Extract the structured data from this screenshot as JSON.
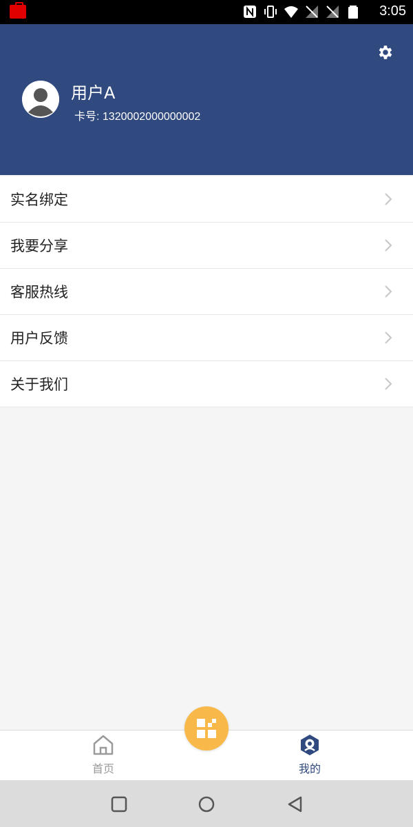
{
  "status_bar": {
    "time": "3:05",
    "icons": [
      "notification-app-icon",
      "nfc-icon",
      "vibrate-icon",
      "wifi-icon",
      "signal-off-icon",
      "signal-off-icon",
      "battery-icon"
    ]
  },
  "header": {
    "background": "#30497f",
    "user_name": "用户A",
    "card_number": "卡号: 1320002000000002",
    "settings_icon": "gear-icon",
    "avatar_icon": "user-avatar-icon"
  },
  "menu": {
    "items": [
      {
        "label": "实名绑定"
      },
      {
        "label": "我要分享"
      },
      {
        "label": "客服热线"
      },
      {
        "label": "用户反馈"
      },
      {
        "label": "关于我们"
      }
    ]
  },
  "tabbar": {
    "home_label": "首页",
    "mine_label": "我的",
    "active_color": "#30497f",
    "inactive_color": "#9a9a9a",
    "scan_button_color": "#f8b94a"
  },
  "nav_bar": {
    "buttons": [
      "recent-apps-icon",
      "home-icon",
      "back-icon"
    ]
  }
}
